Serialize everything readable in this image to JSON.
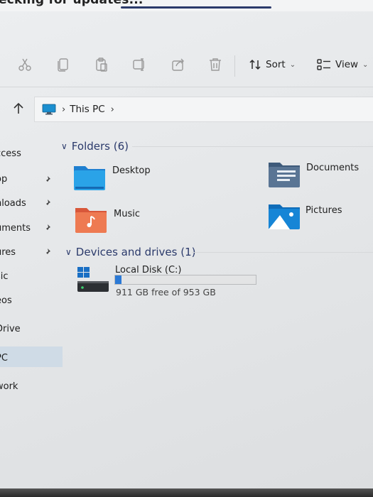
{
  "update_bar": {
    "title": "ecking for updates..."
  },
  "toolbar": {
    "sort_label": "Sort",
    "view_label": "View",
    "icons": [
      "cut-icon",
      "copy-icon",
      "paste-icon",
      "rename-icon",
      "share-icon",
      "delete-icon"
    ]
  },
  "address": {
    "crumb": "This PC"
  },
  "sidebar": {
    "items": [
      {
        "label": "ccess"
      },
      {
        "label": "op"
      },
      {
        "label": "nloads"
      },
      {
        "label": "uments"
      },
      {
        "label": "ures"
      },
      {
        "label": "sic"
      },
      {
        "label": "eos"
      },
      {
        "label": "Drive"
      },
      {
        "label": "PC"
      },
      {
        "label": "work"
      }
    ]
  },
  "folders": {
    "header": "Folders (6)",
    "items": [
      {
        "label": "Desktop"
      },
      {
        "label": "Documents"
      },
      {
        "label": "Music"
      },
      {
        "label": "Pictures"
      }
    ]
  },
  "drives": {
    "header": "Devices and drives (1)",
    "items": [
      {
        "label": "Local Disk (C:)",
        "free_text": "911 GB free of 953 GB",
        "used_fraction": 0.044
      }
    ]
  },
  "colors": {
    "accent": "#2b3a6b",
    "drive_fill": "#2b79d6",
    "selected": "#cfdbe6"
  }
}
